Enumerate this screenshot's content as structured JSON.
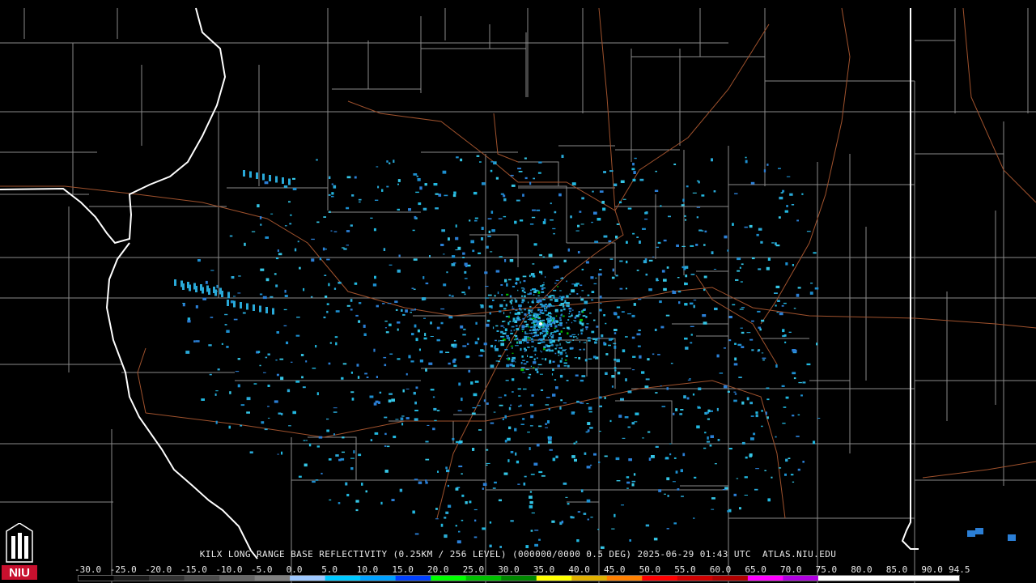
{
  "product": {
    "caption": "KILX LONG RANGE BASE REFLECTIVITY (0.25KM / 256 LEVEL) (000000/0000 0.5 DEG) 2025-06-29 01:43 UTC  ATLAS.NIU.EDU",
    "logo_text": "NIU"
  },
  "scale": {
    "labels": [
      "-30.0",
      "-25.0",
      "-20.0",
      "-15.0",
      "-10.0",
      "-5.0",
      "0.0",
      "5.0",
      "10.0",
      "15.0",
      "20.0",
      "25.0",
      "30.0",
      "35.0",
      "40.0",
      "45.0",
      "50.0",
      "55.0",
      "60.0",
      "65.0",
      "70.0",
      "75.0",
      "80.0",
      "85.0",
      "90.0",
      "94.5"
    ],
    "colors": [
      "#000000",
      "#1a1a1a",
      "#333333",
      "#4d4d4d",
      "#666666",
      "#808080",
      "#9ec8ff",
      "#00c8ff",
      "#00a0ff",
      "#0040ff",
      "#00ff00",
      "#00c000",
      "#008800",
      "#ffff00",
      "#e0b000",
      "#ff8000",
      "#ff0000",
      "#d00000",
      "#b00000",
      "#ff00ff",
      "#b000e0",
      "#ffffff",
      "#ffffff",
      "#ffffff",
      "#ffffff"
    ]
  },
  "colors": {
    "background": "#000000",
    "county_lines": "#8a8a8a",
    "state_lines": "#ffffff",
    "highways": "#a0522d",
    "echo_primary": "#29a9d8"
  }
}
